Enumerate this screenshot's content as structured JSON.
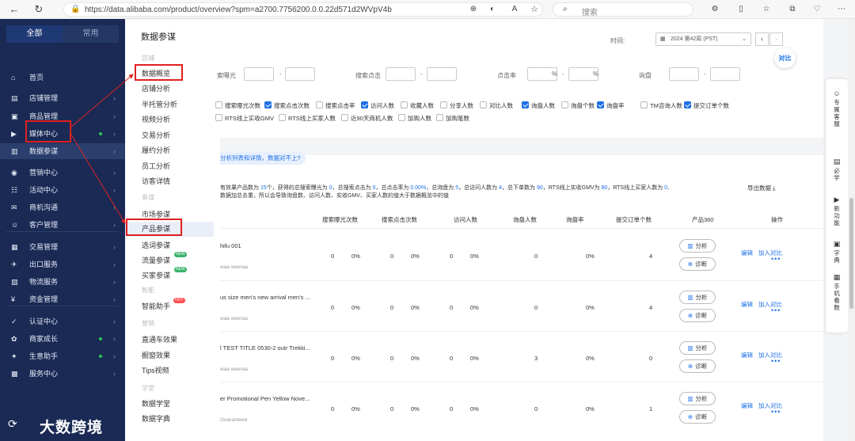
{
  "browser": {
    "url": "https://data.alibaba.com/product/overview?spm=a2700.7756200.0.0.22d571d2WVpV4b",
    "search_placeholder": "搜索"
  },
  "sidenav": {
    "tab_all": "全部",
    "tab_common": "常用",
    "items": [
      {
        "label": "首页",
        "icon": "⌂"
      },
      {
        "label": "店铺管理",
        "icon": "▤"
      },
      {
        "label": "商品管理",
        "icon": "▣"
      },
      {
        "label": "媒体中心",
        "icon": "▶"
      },
      {
        "label": "数据参谋",
        "icon": "▥"
      },
      {
        "label": "营销中心",
        "icon": "◉"
      },
      {
        "label": "活动中心",
        "icon": "☷"
      },
      {
        "label": "商机沟通",
        "icon": "✉"
      },
      {
        "label": "客户管理",
        "icon": "☺"
      },
      {
        "label": "交易管理",
        "icon": "▦"
      },
      {
        "label": "出口服务",
        "icon": "✈"
      },
      {
        "label": "物流服务",
        "icon": "▧"
      },
      {
        "label": "资金管理",
        "icon": "¥"
      },
      {
        "label": "认证中心",
        "icon": "✓"
      },
      {
        "label": "商家成长",
        "icon": "✿"
      },
      {
        "label": "生意助手",
        "icon": "✦"
      },
      {
        "label": "服务中心",
        "icon": "▩"
      }
    ]
  },
  "submenu": {
    "title": "数据参谋",
    "group_store": "店铺",
    "store_items": [
      "数据概览",
      "店铺分析",
      "半托管分析",
      "视频分析",
      "交易分析",
      "履约分析",
      "员工分析",
      "访客详情"
    ],
    "group_advisor": "参谋",
    "advisor_items": [
      "市场参谋",
      "产品参谋",
      "选词参谋",
      "流量参谋",
      "买家参谋"
    ],
    "group_smart": "智能",
    "smart_items": [
      "智能助手"
    ],
    "group_marketing": "营销",
    "marketing_items": [
      "直通车效果",
      "橱窗效果",
      "Tips视频"
    ],
    "group_learn": "学堂",
    "learn_items": [
      "数据学堂",
      "数据字典"
    ],
    "badge_new": "NEW",
    "badge_hot": "HOT"
  },
  "filters": {
    "time_label": "时间:",
    "date_value": "2024 第42周 (PST)",
    "compare": "对比",
    "exposure": "索曝光",
    "clicks": "搜索点击",
    "ctr": "点击率",
    "inquiry": "询盘",
    "percent": "%"
  },
  "checkboxes": [
    {
      "label": "搜索曝光次数",
      "on": false
    },
    {
      "label": "搜索点击次数",
      "on": true
    },
    {
      "label": "搜索点击率",
      "on": false
    },
    {
      "label": "访问人数",
      "on": true
    },
    {
      "label": "收藏人数",
      "on": false
    },
    {
      "label": "分享人数",
      "on": false
    },
    {
      "label": "对比人数",
      "on": false
    },
    {
      "label": "询盘人数",
      "on": true
    },
    {
      "label": "询盘个数",
      "on": false
    },
    {
      "label": "询盘率",
      "on": true
    },
    {
      "label": "TM咨询人数",
      "on": false
    },
    {
      "label": "提交订单个数",
      "on": true
    },
    {
      "label": "RTS线上实收GMV",
      "on": false
    },
    {
      "label": "RTS线上买家人数",
      "on": false
    },
    {
      "label": "近90天商机人数",
      "on": false
    },
    {
      "label": "加购人数",
      "on": false
    },
    {
      "label": "加购笔数",
      "on": false
    }
  ],
  "tip": "分析列表和详情，数据对不上?",
  "summary": {
    "line1_a": "有效果产品数为",
    "count": "15",
    "line1_b": "个，获得的总搜索曝光为",
    "exposure": "0",
    "line1_c": "，总搜索点击为",
    "clicks": "0",
    "line1_d": "，总点击率为",
    "ctr": "0.00%",
    "line1_e": "，总询盘为",
    "inquiries": "5",
    "line1_f": "，总访问人数为",
    "visitors": "4",
    "line1_g": "，总下单数为",
    "orders": "90",
    "line1_h": "，RTS线上实收GMV为",
    "gmv": "80",
    "line1_i": "，RTS线上买家人数为",
    "buyers": "0",
    "line2": "数据加总去重，所以会导致询盘数、访问人数、实收GMV、买家人数的值大于数据概览中的值",
    "export": "导出数据"
  },
  "table": {
    "headers": [
      "搜索曝光次数",
      "搜索点击次数",
      "访问人数",
      "询盘人数",
      "询盘率",
      "提交订单个数",
      "产品360",
      "操作"
    ],
    "btn_analyze": "分析",
    "btn_diagnose": "诊断",
    "op_edit": "编辑",
    "op_compare": "加入对比",
    "rows": [
      {
        "title": "hifu 001",
        "sub": "waa weeraa",
        "exp": "0",
        "exp_pct": "0%",
        "clk": "0",
        "clk_pct": "0%",
        "vis": "0",
        "vis_pct": "0%",
        "inq": "0",
        "rate": "0%",
        "orders": "4"
      },
      {
        "title": "us size men's new arrival men's ...",
        "sub": "waa weeraa",
        "exp": "0",
        "exp_pct": "0%",
        "clk": "0",
        "clk_pct": "0%",
        "vis": "0",
        "vis_pct": "0%",
        "inq": "0",
        "rate": "0%",
        "orders": "4"
      },
      {
        "title": "l TEST TITLE 0530-2 outr Trekki...",
        "sub": "waa weeraa",
        "exp": "0",
        "exp_pct": "0%",
        "clk": "0",
        "clk_pct": "0%",
        "vis": "0",
        "vis_pct": "0%",
        "inq": "3",
        "rate": "0%",
        "orders": "0"
      },
      {
        "title": "er Promotional Pen Yellow Nove...",
        "sub": "Guaranteed",
        "exp": "0",
        "exp_pct": "0%",
        "clk": "0",
        "clk_pct": "0%",
        "vis": "0",
        "vis_pct": "0%",
        "inq": "0",
        "rate": "0%",
        "orders": "1"
      }
    ]
  },
  "rightbar": {
    "service": "专属客服",
    "must": "必学",
    "newfeat": "新功能",
    "dict": "字典",
    "mobile": "手机看数"
  },
  "watermark": "大数跨境"
}
